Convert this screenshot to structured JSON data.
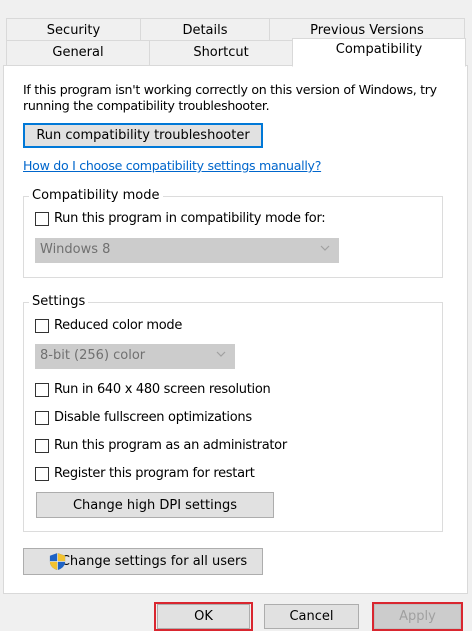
{
  "tabs": {
    "row1": [
      "Security",
      "Details",
      "Previous Versions"
    ],
    "row2": [
      "General",
      "Shortcut",
      "Compatibility"
    ]
  },
  "intro_text": {
    "line1": "If this program isn't working correctly on this version of Windows, try",
    "line2": "running the compatibility troubleshooter."
  },
  "troubleshooter_button": "Run compatibility troubleshooter",
  "manual_link": "How do I choose compatibility settings manually?",
  "compat_mode": {
    "legend": "Compatibility mode",
    "checkbox_label": "Run this program in compatibility mode for:",
    "checked": false,
    "select_value": "Windows 8"
  },
  "settings": {
    "legend": "Settings",
    "reduced_color_label": "Reduced color mode",
    "color_select_value": "8-bit (256) color",
    "res_640_label": "Run in 640 x 480 screen resolution",
    "fullscreen_opt_label": "Disable fullscreen optimizations",
    "admin_label": "Run this program as an administrator",
    "restart_label": "Register this program for restart",
    "dpi_button": "Change high DPI settings"
  },
  "all_users_button": "Change settings for all users",
  "footer": {
    "ok": "OK",
    "cancel": "Cancel",
    "apply": "Apply"
  },
  "colors": {
    "accent": "#0078d7",
    "link": "#0066cc",
    "highlight": "#d9262f"
  }
}
